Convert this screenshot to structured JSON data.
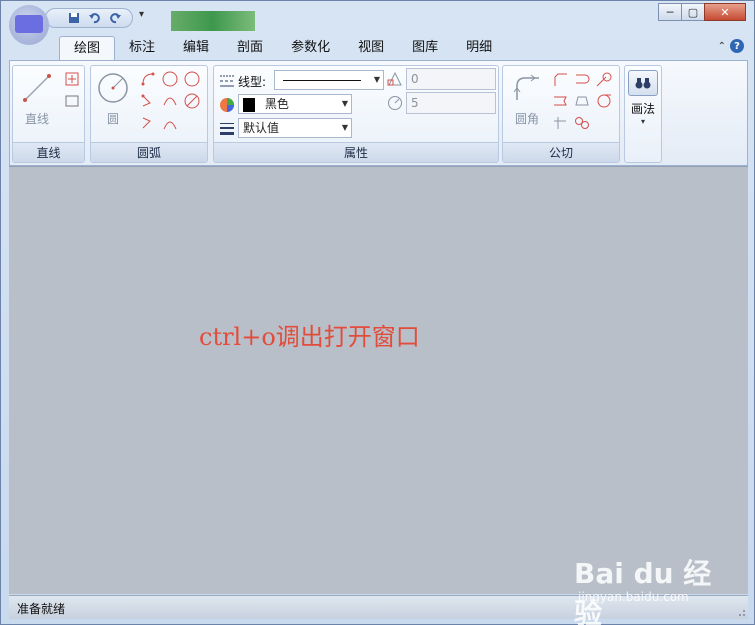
{
  "titlebar": {
    "qat": {
      "save": "save-icon",
      "undo": "undo-icon",
      "redo": "redo-icon",
      "more": "▾"
    },
    "window_controls": {
      "minimize": "─",
      "maximize": "▢",
      "close": "✕"
    }
  },
  "tabs": [
    "绘图",
    "标注",
    "编辑",
    "剖面",
    "参数化",
    "视图",
    "图库",
    "明细"
  ],
  "help": {
    "expand": "⌃",
    "icon": "?"
  },
  "ribbon": {
    "groups": {
      "line": {
        "label": "直线",
        "button": "直线"
      },
      "circle": {
        "label": "圆弧",
        "button": "圆"
      },
      "props": {
        "label": "属性",
        "linetype_label": "线型:",
        "color_value": "黑色",
        "lineweight_value": "默认值",
        "num1": "0",
        "num2": "5"
      },
      "fillet": {
        "label": "公切",
        "button": "圆角"
      },
      "method": {
        "button": "画法",
        "dropdown": "▾"
      }
    }
  },
  "canvas": {
    "note": "ctrl+o调出打开窗口"
  },
  "status": {
    "text": "准备就绪"
  },
  "watermark": {
    "logo": "Bai du 经验",
    "url": "jingyan.baidu.com"
  },
  "colors": {
    "accent": "#2f67b6",
    "note": "#e24c3a",
    "client_bg": "#b9bfc9"
  }
}
